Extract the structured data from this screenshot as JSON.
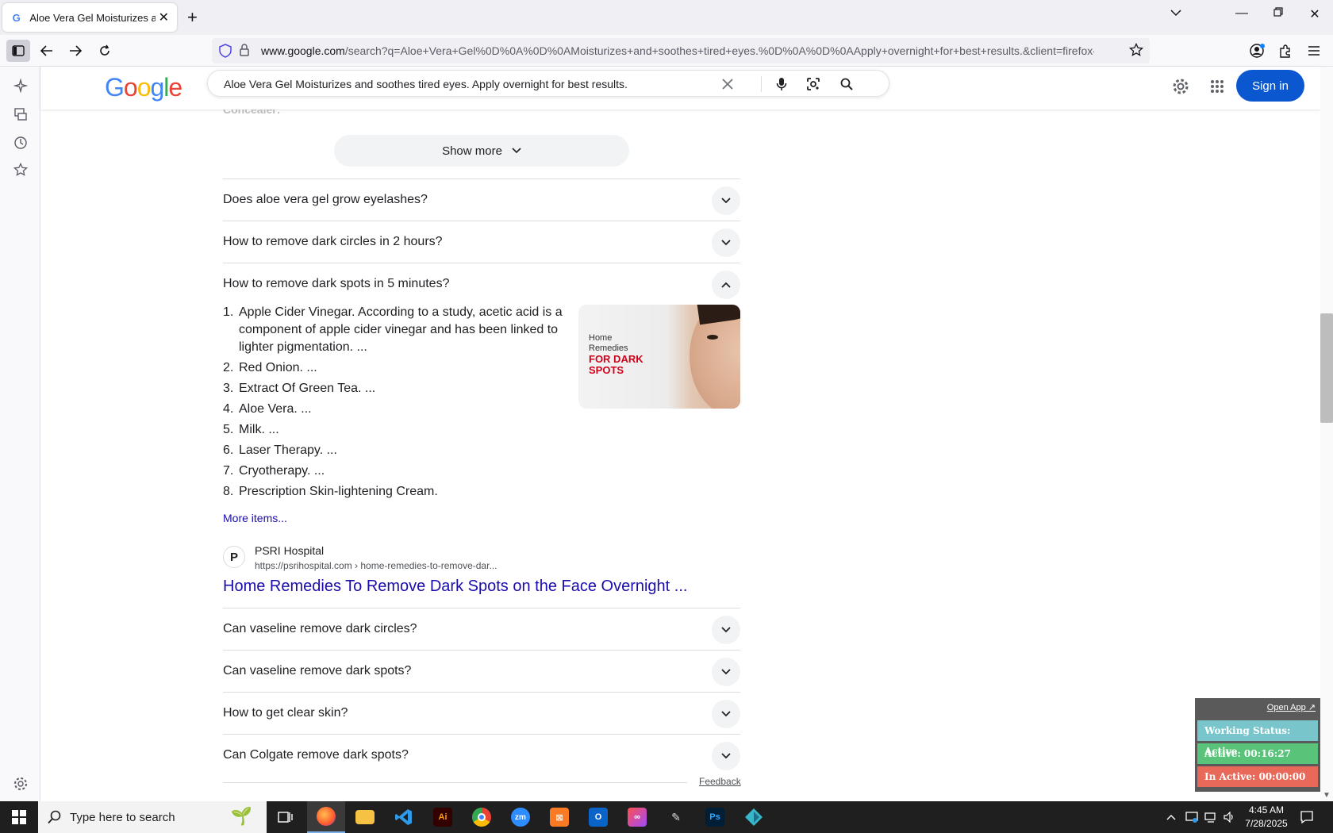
{
  "browser": {
    "tab_title": "Aloe Vera Gel Moisturizes and soothes tired eyes.",
    "url_domain": "www.google.com",
    "url_rest": "/search?q=Aloe+Vera+Gel%0D%0A%0D%0AMoisturizes+and+soothes+tired+eyes.%0D%0A%0D%0AApply+overnight+for+best+results.&client=firefox-b-d&sca_esv"
  },
  "google": {
    "logo_letters": [
      "G",
      "o",
      "o",
      "g",
      "l",
      "e"
    ],
    "logo_colors": [
      "#4285f4",
      "#ea4335",
      "#fbbc05",
      "#4285f4",
      "#34a853",
      "#ea4335"
    ],
    "query": "Aloe Vera Gel Moisturizes and soothes tired eyes. Apply overnight for best results.",
    "sign_in": "Sign in"
  },
  "content": {
    "faded_label": "Concealer:",
    "show_more": "Show more",
    "faqs_top": [
      "Does aloe vera gel grow eyelashes?",
      "How to remove dark circles in 2 hours?",
      "How to remove dark spots in 5 minutes?"
    ],
    "answer_items": [
      "Apple Cider Vinegar. According to a study, acetic acid is a component of apple cider vinegar and has been linked to lighter pigmentation. ...",
      "Red Onion. ...",
      "Extract Of Green Tea. ...",
      "Aloe Vera. ...",
      "Milk. ...",
      "Laser Therapy. ...",
      "Cryotherapy. ...",
      "Prescription Skin-lightening Cream."
    ],
    "thumb_line1": "Home",
    "thumb_line2": "Remedies",
    "thumb_line3": "FOR DARK",
    "thumb_line4": "SPOTS",
    "more_items": "More items...",
    "source_name": "PSRI Hospital",
    "source_url": "https://psrihospital.com › home-remedies-to-remove-dar...",
    "source_title": "Home Remedies To Remove Dark Spots on the Face Overnight ...",
    "faqs_bottom": [
      "Can vaseline remove dark circles?",
      "Can vaseline remove dark spots?",
      "How to get clear skin?",
      "Can Colgate remove dark spots?"
    ],
    "feedback": "Feedback"
  },
  "tracker": {
    "open_app": "Open App ↗",
    "working_status": "Working Status: Active",
    "active": "Active: 00:16:27",
    "inactive": "In Active: 00:00:00"
  },
  "taskbar": {
    "search_placeholder": "Type here to search",
    "time": "4:45 AM",
    "date": "7/28/2025",
    "apps": [
      "task-view",
      "firefox",
      "file-explorer",
      "vscode",
      "illustrator",
      "chrome",
      "zoom",
      "xampp",
      "outlook",
      "creative-cloud",
      "pen-tool",
      "photoshop",
      "app"
    ]
  }
}
